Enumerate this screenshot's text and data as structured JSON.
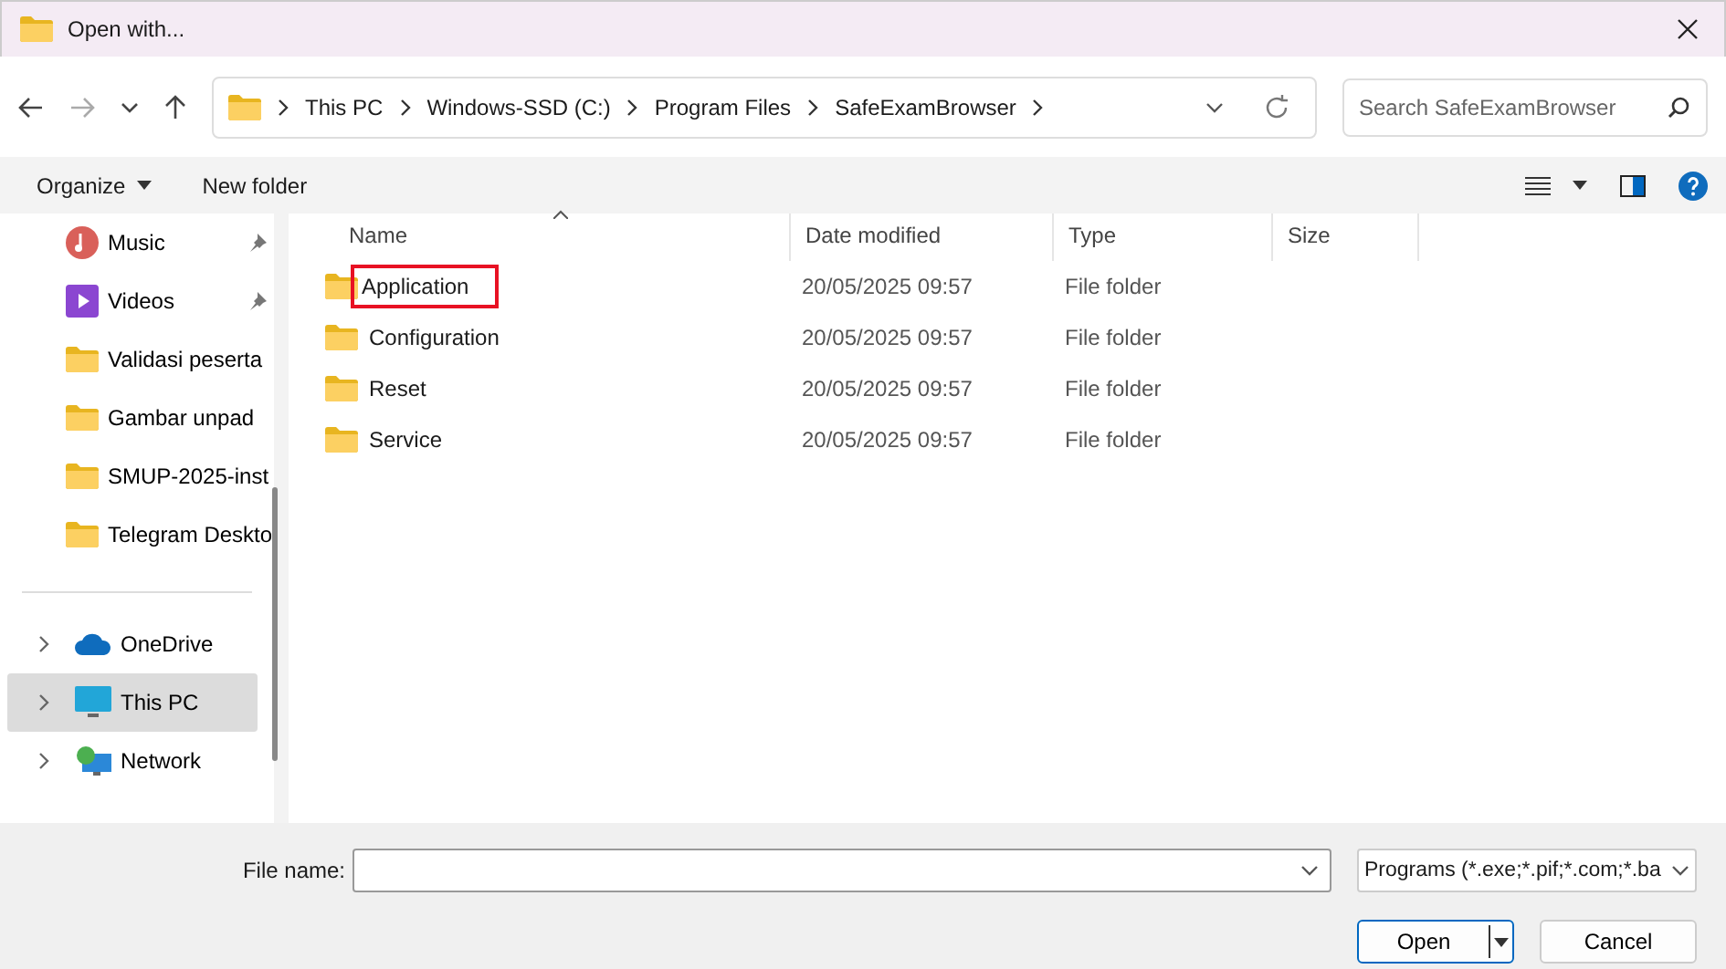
{
  "window": {
    "title": "Open with..."
  },
  "breadcrumb": [
    "This PC",
    "Windows-SSD (C:)",
    "Program Files",
    "SafeExamBrowser"
  ],
  "search": {
    "placeholder": "Search SafeExamBrowser"
  },
  "toolbar": {
    "organize": "Organize",
    "new_folder": "New folder"
  },
  "sidebar": {
    "items": [
      {
        "label": "Music",
        "kind": "music",
        "pinned": true,
        "selected": false
      },
      {
        "label": "Videos",
        "kind": "videos",
        "pinned": true,
        "selected": false
      },
      {
        "label": "Validasi peserta",
        "kind": "folder",
        "pinned": false,
        "selected": false
      },
      {
        "label": "Gambar unpad",
        "kind": "folder",
        "pinned": false,
        "selected": false
      },
      {
        "label": "SMUP-2025-inst",
        "kind": "folder",
        "pinned": false,
        "selected": false
      },
      {
        "label": "Telegram Deskto",
        "kind": "folder",
        "pinned": false,
        "selected": false
      }
    ],
    "locations": [
      {
        "label": "OneDrive",
        "kind": "cloud",
        "selected": false
      },
      {
        "label": "This PC",
        "kind": "pc",
        "selected": true
      },
      {
        "label": "Network",
        "kind": "network",
        "selected": false
      }
    ]
  },
  "table": {
    "columns": [
      "Name",
      "Date modified",
      "Type",
      "Size"
    ],
    "rows": [
      {
        "name": "Application",
        "date": "20/05/2025 09:57",
        "type": "File folder",
        "highlighted": true
      },
      {
        "name": "Configuration",
        "date": "20/05/2025 09:57",
        "type": "File folder",
        "highlighted": false
      },
      {
        "name": "Reset",
        "date": "20/05/2025 09:57",
        "type": "File folder",
        "highlighted": false
      },
      {
        "name": "Service",
        "date": "20/05/2025 09:57",
        "type": "File folder",
        "highlighted": false
      }
    ]
  },
  "footer": {
    "file_name_label": "File name:",
    "file_type": "Programs (*.exe;*.pif;*.com;*.ba",
    "open": "Open",
    "cancel": "Cancel"
  }
}
